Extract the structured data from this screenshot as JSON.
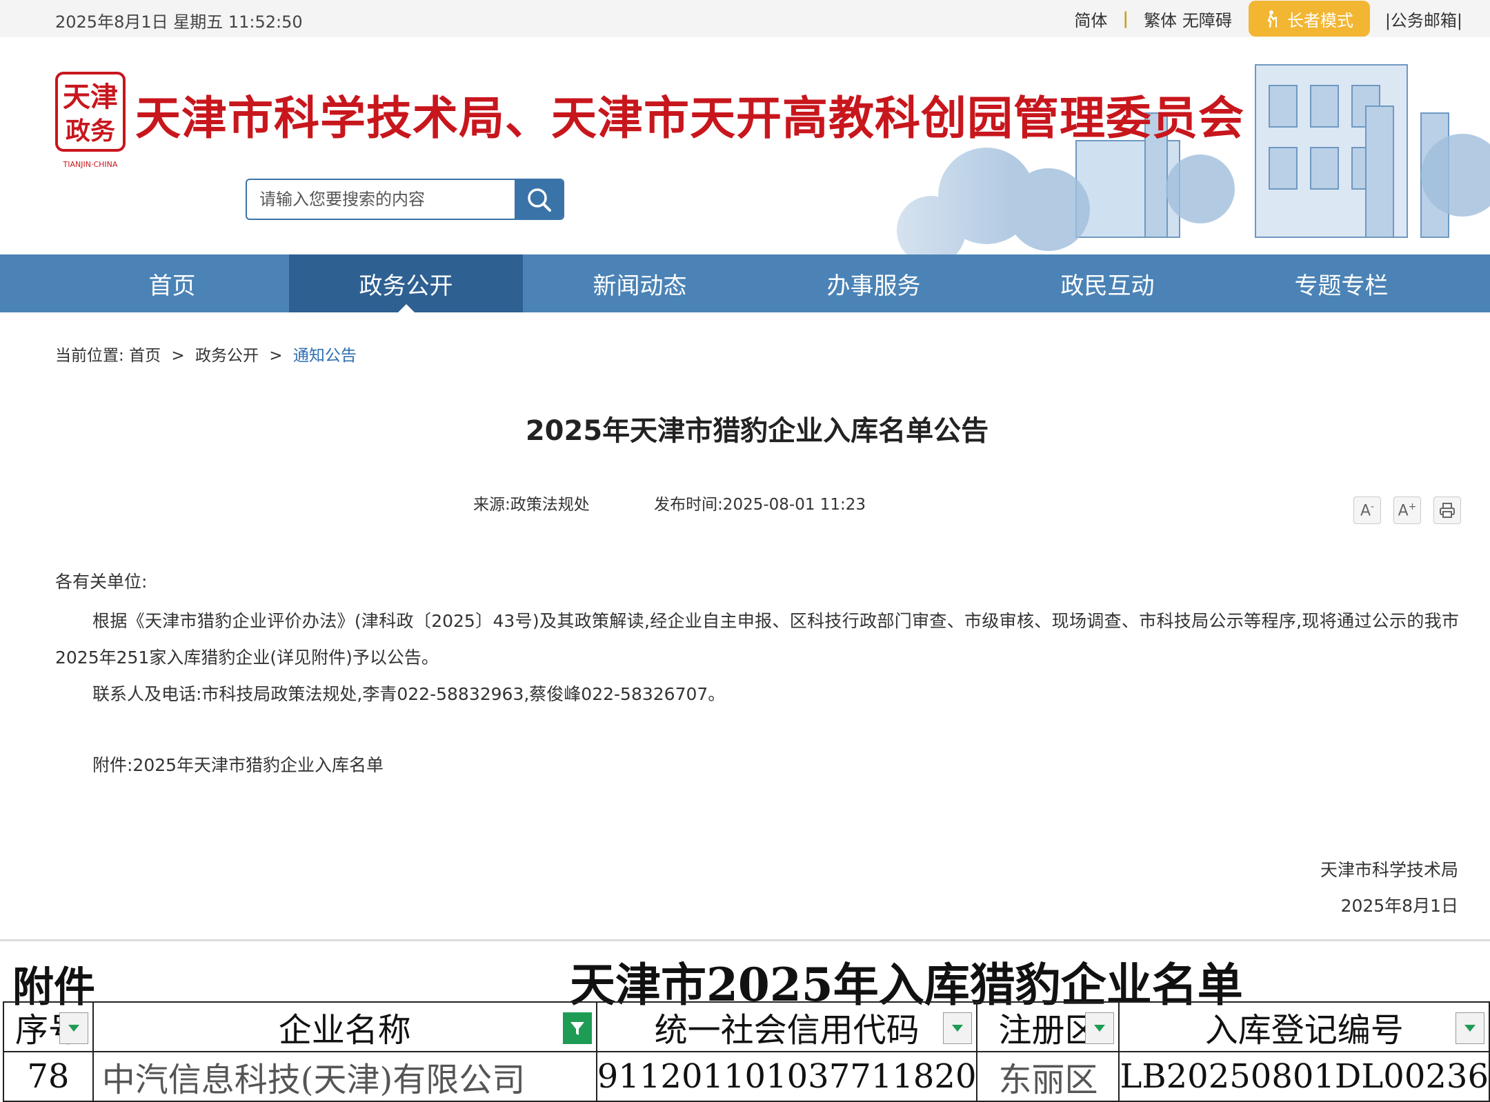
{
  "topbar": {
    "datetime": "2025年8月1日  星期五   11:52:50",
    "simplified": "简体",
    "traditional": "繁体",
    "accessibility": "无障碍",
    "elder_mode": "长者模式",
    "mailbox": "|公务邮箱|"
  },
  "header": {
    "site_title": "天津市科学技术局、天津市天开高教科创园管理委员会",
    "logo_caption": "TIANJIN·CHINA",
    "search_placeholder": "请输入您要搜索的内容"
  },
  "nav": {
    "items": [
      "首页",
      "政务公开",
      "新闻动态",
      "办事服务",
      "政民互动",
      "专题专栏"
    ],
    "active_index": 1
  },
  "breadcrumb": {
    "prefix": "当前位置:",
    "items": [
      "首页",
      "政务公开",
      "通知公告"
    ]
  },
  "article": {
    "title": "2025年天津市猎豹企业入库名单公告",
    "source": "来源:政策法规处",
    "published": "发布时间:2025-08-01 11:23",
    "font_decrease": "A-",
    "font_increase": "A+",
    "greeting": "各有关单位:",
    "paragraph1": "根据《天津市猎豹企业评价办法》(津科政〔2025〕43号)及其政策解读,经企业自主申报、区科技行政部门审查、市级审核、现场调查、市科技局公示等程序,现将通过公示的我市2025年251家入库猎豹企业(详见附件)予以公告。",
    "contact": "联系人及电话:市科技局政策法规处,李青022-58832963,蔡俊峰022-58326707。",
    "attachment": "附件:2025年天津市猎豹企业入库名单",
    "signer": "天津市科学技术局",
    "sign_date": "2025年8月1日"
  },
  "attachment_table": {
    "label": "附件",
    "title": "天津市2025年入库猎豹企业名单",
    "columns": [
      "序号",
      "企业名称",
      "统一社会信用代码",
      "注册区",
      "入库登记编号"
    ],
    "rows": [
      [
        "78",
        "中汽信息科技(天津)有限公司",
        "911201101037711820",
        "东丽区",
        "LB20250801DL00236"
      ]
    ]
  },
  "colors": {
    "brand_red": "#c8161d",
    "nav_blue": "#4b83b6",
    "nav_active": "#2e6092",
    "elder_gold": "#f2b632",
    "filter_green": "#1e9b55"
  }
}
